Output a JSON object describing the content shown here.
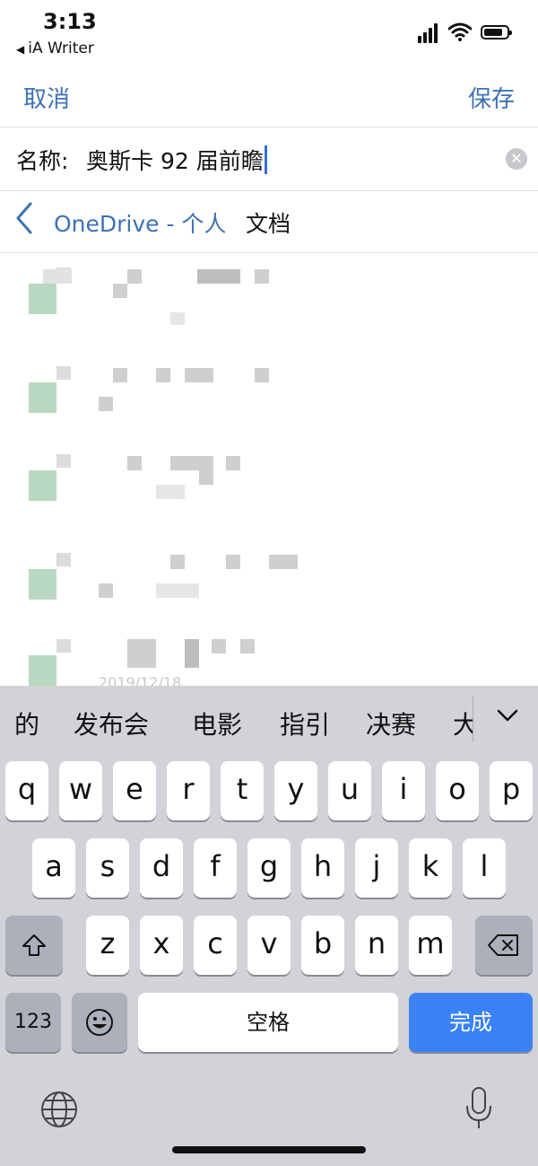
{
  "status_bar": {
    "time": "3:13",
    "back_app": "iA Writer"
  },
  "nav": {
    "cancel_label": "取消",
    "save_label": "保存"
  },
  "name_field": {
    "label": "名称:",
    "value": "奥斯卡 92 届前瞻"
  },
  "breadcrumb": {
    "parent": "OneDrive - 个人",
    "current": "文档"
  },
  "files": {
    "visible_date": "2019/12/18"
  },
  "keyboard": {
    "candidates": [
      "的",
      "发布会",
      "电影",
      "指引",
      "决赛",
      "大"
    ],
    "row1": [
      "q",
      "w",
      "e",
      "r",
      "t",
      "y",
      "u",
      "i",
      "o",
      "p"
    ],
    "row2": [
      "a",
      "s",
      "d",
      "f",
      "g",
      "h",
      "j",
      "k",
      "l"
    ],
    "row3": [
      "z",
      "x",
      "c",
      "v",
      "b",
      "n",
      "m"
    ],
    "numbers_label": "123",
    "space_label": "空格",
    "done_label": "完成"
  },
  "colors": {
    "accent": "#3d72b4",
    "keyboard_bg": "#d1d3d8",
    "done_key": "#3a82f6"
  }
}
